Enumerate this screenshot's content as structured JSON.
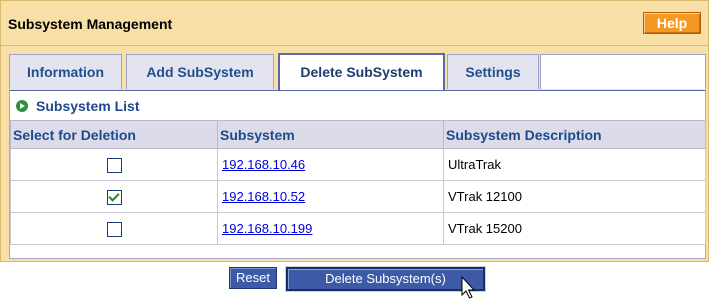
{
  "header": {
    "title": "Subsystem Management",
    "help_label": "Help"
  },
  "tabs": [
    {
      "label": "Information",
      "active": false
    },
    {
      "label": "Add SubSystem",
      "active": false
    },
    {
      "label": "Delete SubSystem",
      "active": true
    },
    {
      "label": "Settings",
      "active": false
    }
  ],
  "section": {
    "icon": "arrow-right-circle-icon",
    "title": "Subsystem List"
  },
  "table": {
    "columns": [
      "Select for Deletion",
      "Subsystem",
      "Subsystem Description"
    ],
    "rows": [
      {
        "selected": false,
        "subsystem": "192.168.10.46",
        "description": "UltraTrak"
      },
      {
        "selected": true,
        "subsystem": "192.168.10.52",
        "description": "VTrak 12100"
      },
      {
        "selected": false,
        "subsystem": "192.168.10.199",
        "description": "VTrak 15200"
      }
    ]
  },
  "actions": {
    "reset_label": "Reset",
    "delete_label": "Delete Subsystem(s)"
  },
  "colors": {
    "panel_bg": "#f8dfa6",
    "help_button": "#f39a23",
    "tab_text": "#1f4f8c",
    "action_button": "#3c5aa6",
    "link": "#0000d8"
  }
}
